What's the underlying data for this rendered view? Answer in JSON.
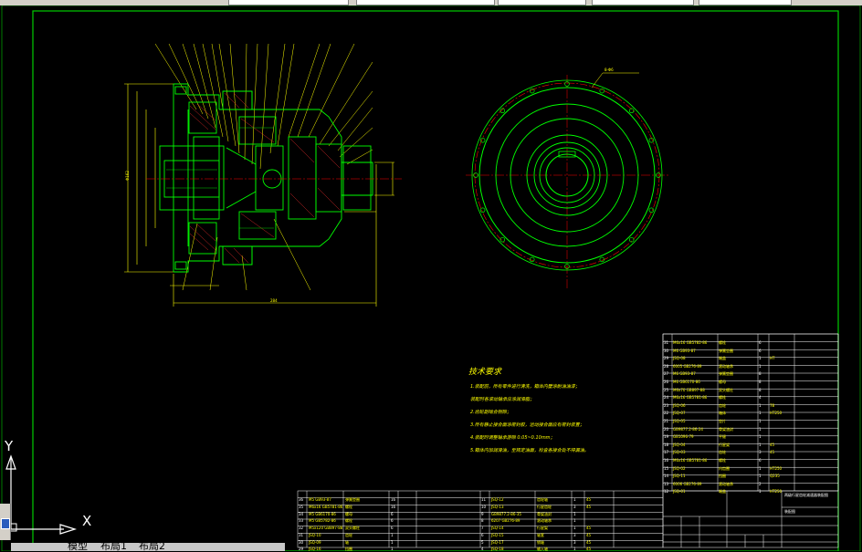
{
  "window": {
    "colors": {
      "background": "#000000",
      "frame": "#00cc00",
      "part": "#00ff00",
      "dimension": "#ffff00",
      "centerline": "#ff0000",
      "table_line": "#ffffff"
    }
  },
  "ucs": {
    "x_label": "X",
    "y_label": "Y"
  },
  "layout_tabs": [
    "模型",
    "布局1",
    "布局2"
  ],
  "drawing": {
    "tech_requirements": {
      "title": "技术要求",
      "lines": [
        "1.装配前，所有零件进行清洗，箱体内壁涂耐油油漆；",
        "  装配时各滚动轴承应涂润滑脂；",
        "2.齿轮副啮合侧隙；",
        "3.所有静止接合面涂密封胶，运动接合面应有密封装置；",
        "4.装配时调整轴承游隙 0.05~0.10mm；",
        "5.箱体内加润滑油，至规定油面，检查各接合处不得漏油。"
      ]
    },
    "title_block": {
      "title": "两级行星齿轮减速器装配图",
      "drawing_no": "装配图"
    },
    "bom_right": [
      {
        "no": "31",
        "code": "M6x16 GB5782-86",
        "name": "螺栓",
        "qty": "6",
        "mat": "",
        "note": ""
      },
      {
        "no": "30",
        "code": "M6 GB93-87",
        "name": "弹簧垫圈",
        "qty": "6",
        "mat": "",
        "note": ""
      },
      {
        "no": "29",
        "code": "JSQ-08",
        "name": "端盖",
        "qty": "1",
        "mat": "HT",
        "note": ""
      },
      {
        "no": "28",
        "code": "6005 GB276-89",
        "name": "滚动轴承",
        "qty": "1",
        "mat": "",
        "note": ""
      },
      {
        "no": "27",
        "code": "M6 GB93-87",
        "name": "弹簧垫圈",
        "qty": "8",
        "mat": "",
        "note": ""
      },
      {
        "no": "26",
        "code": "M6 GB6170-86",
        "name": "螺母",
        "qty": "8",
        "mat": "",
        "note": ""
      },
      {
        "no": "25",
        "code": "M6x70 GB897-88",
        "name": "双头螺柱",
        "qty": "8",
        "mat": "",
        "note": ""
      },
      {
        "no": "24",
        "code": "M6x16 GB5781-86",
        "name": "螺栓",
        "qty": "4",
        "mat": "",
        "note": ""
      },
      {
        "no": "23",
        "code": "JSQ-06",
        "name": "齿轮",
        "qty": "1",
        "mat": "78",
        "note": ""
      },
      {
        "no": "22",
        "code": "JSQ-07",
        "name": "箱体",
        "qty": "1",
        "mat": "HT250",
        "note": ""
      },
      {
        "no": "21",
        "code": "JSQ-05",
        "name": "垫片",
        "qty": "1",
        "mat": "",
        "note": ""
      },
      {
        "no": "20",
        "code": "GB9877.2-86-24",
        "name": "骨架油封",
        "qty": "1",
        "mat": "",
        "note": ""
      },
      {
        "no": "19",
        "code": "GB1096-79",
        "name": "平键",
        "qty": "1",
        "mat": "",
        "note": ""
      },
      {
        "no": "18",
        "code": "JSQ-04",
        "name": "行星架",
        "qty": "1",
        "mat": "45",
        "note": ""
      },
      {
        "no": "17",
        "code": "JSQ-03",
        "name": "齿轮",
        "qty": "3",
        "mat": "45",
        "note": ""
      },
      {
        "no": "16",
        "code": "M6x16 GB5781-86",
        "name": "螺栓",
        "qty": "6",
        "mat": "",
        "note": ""
      },
      {
        "no": "15",
        "code": "JSQ-02",
        "name": "内齿圈",
        "qty": "1",
        "mat": "HT250",
        "note": ""
      },
      {
        "no": "14",
        "code": "JSQ-11",
        "name": "挡圈",
        "qty": "1",
        "mat": "Q235",
        "note": ""
      },
      {
        "no": "13",
        "code": "6006 GB276-89",
        "name": "滚动轴承",
        "qty": "2",
        "mat": "",
        "note": ""
      },
      {
        "no": "12",
        "code": "JSQ-01",
        "name": "端盖",
        "qty": "1",
        "mat": "HT250",
        "note": ""
      }
    ],
    "bom_bottom_left": [
      {
        "no": "36",
        "code": "M5 GB93-87",
        "name": "弹簧垫圈",
        "qty": "16"
      },
      {
        "no": "35",
        "code": "M6x16 GB5781-86",
        "name": "螺栓",
        "qty": "16"
      },
      {
        "no": "34",
        "code": "M5 GB6170-86",
        "name": "螺母",
        "qty": "6"
      },
      {
        "no": "33",
        "code": "M5 GB5782-86",
        "name": "螺栓",
        "qty": "6"
      },
      {
        "no": "32",
        "code": "M5x120 GB897-88",
        "name": "双头螺柱",
        "qty": "6"
      },
      {
        "no": "31",
        "code": "JSQ-10",
        "name": "齿轮",
        "qty": "1"
      },
      {
        "no": "30",
        "code": "JSQ-09",
        "name": "轴",
        "qty": "1"
      },
      {
        "no": "29",
        "code": "JSQ-16",
        "name": "挡圈",
        "qty": "1"
      }
    ],
    "bom_bottom_mid": [
      {
        "no": "11",
        "code": "JSQ-12",
        "name": "齿轮轴",
        "qty": "1",
        "mat": "45"
      },
      {
        "no": "10",
        "code": "JSQ-13",
        "name": "行星齿轮",
        "qty": "3",
        "mat": "45"
      },
      {
        "no": "9",
        "code": "GB9877.2-86-35",
        "name": "骨架油封",
        "qty": "1"
      },
      {
        "no": "8",
        "code": "6207 GB276-89",
        "name": "滚动轴承",
        "qty": "1"
      },
      {
        "no": "7",
        "code": "JSQ-14",
        "name": "行星架",
        "qty": "1",
        "mat": "45"
      },
      {
        "no": "6",
        "code": "JSQ-15",
        "name": "轴套",
        "qty": "3",
        "mat": "45"
      },
      {
        "no": "5",
        "code": "JSQ-17",
        "name": "销轴",
        "qty": "3",
        "mat": "45"
      },
      {
        "no": "4",
        "code": "JSQ-18",
        "name": "输入轴",
        "qty": "1",
        "mat": "45"
      }
    ],
    "dim_labels": {
      "overall_length": "284",
      "flange_dia": "Φ162",
      "detail_note": "8-Φ6"
    }
  }
}
